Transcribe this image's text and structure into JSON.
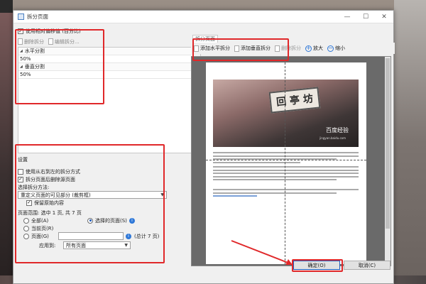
{
  "window": {
    "title": "拆分页面",
    "min_label": "—",
    "max_label": "☐",
    "close_label": "✕"
  },
  "options": {
    "use_relative_offset": {
      "label": "使用相对偏移值 (百分比)",
      "checked": true
    }
  },
  "split_toolbar": {
    "delete_label": "删除拆分",
    "edit_label": "编辑拆分..."
  },
  "split_list": {
    "groups": [
      {
        "label": "水平分割",
        "value": "50%"
      },
      {
        "label": "垂直分割",
        "value": "50%"
      }
    ]
  },
  "settings": {
    "title": "设置",
    "rtl": {
      "label": "使用从右到左的拆分方式",
      "checked": false
    },
    "delete_original": {
      "label": "拆分页面后删除源页面",
      "checked": true
    },
    "method_label": "选择拆分方法:",
    "method_value": "重定义页面的可见部分 (裁剪框)",
    "keep_original": {
      "label": "保留原始内容",
      "checked": true
    }
  },
  "page_range": {
    "title": "页面范围: 选中 1 页, 共 7 页",
    "all_label": "全部(A)",
    "selected_label": "选择的页面(S)",
    "current_label": "当前页(R)",
    "pages_label": "页面(G)",
    "pages_value": "",
    "total_label": "(总计 7 页)",
    "apply_label": "应用到:",
    "apply_value": "所有页面",
    "selected_choice": "selected"
  },
  "preview": {
    "tab_label": "拆分页面 ",
    "add_horizontal_label": "添加水平拆分",
    "add_vertical_label": "添加垂直拆分",
    "delete_label": "删除拆分",
    "zoom_in_label": "放大",
    "zoom_out_label": "缩小",
    "photo_sign": "回 亭 坊",
    "watermark": "百度经验",
    "watermark_sub": "jingyan.baidu.com"
  },
  "buttons": {
    "ok": "确定(O)",
    "cancel": "取消(C)"
  },
  "colors": {
    "annotation": "#e0282a",
    "accent": "#2f78d8"
  }
}
